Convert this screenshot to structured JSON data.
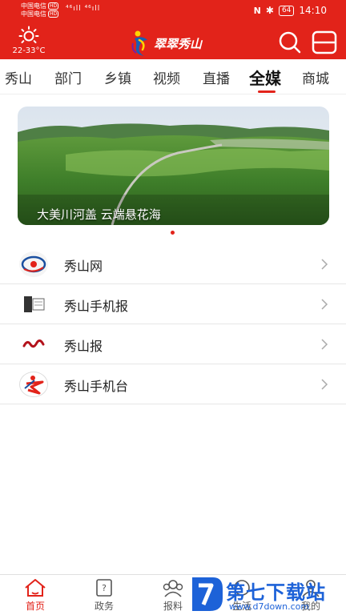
{
  "status_bar": {
    "carrier_1": "中国电信",
    "carrier_2": "中国电信",
    "hd_badge": "HD",
    "signal_text": "⁴⁶ıll ⁴⁶ıll",
    "battery": "64",
    "time": "14:10"
  },
  "header": {
    "temperature": "22-33°C",
    "logo_text": "翠翠秀山",
    "accent_color": "#e2231a"
  },
  "tabs": {
    "items": [
      {
        "label": "秀山"
      },
      {
        "label": "部门"
      },
      {
        "label": "乡镇"
      },
      {
        "label": "视频"
      },
      {
        "label": "直播"
      },
      {
        "label": "全媒"
      },
      {
        "label": "商城"
      }
    ],
    "active": "全媒"
  },
  "banner": {
    "caption": "大美川河盖 云端悬花海"
  },
  "media_list": [
    {
      "label": "秀山网",
      "icon": "xiushan-net-logo"
    },
    {
      "label": "秀山手机报",
      "icon": "mobile-newspaper-logo"
    },
    {
      "label": "秀山报",
      "icon": "xiushan-newspaper-logo"
    },
    {
      "label": "秀山手机台",
      "icon": "mobile-tv-logo"
    }
  ],
  "bottom_nav": {
    "items": [
      {
        "label": "首页",
        "icon": "home-icon"
      },
      {
        "label": "政务",
        "icon": "government-icon"
      },
      {
        "label": "报料",
        "icon": "report-icon"
      },
      {
        "label": "生活",
        "icon": "life-icon"
      },
      {
        "label": "我的",
        "icon": "profile-icon"
      }
    ],
    "active": "首页"
  },
  "watermark": {
    "title": "第七下载站",
    "url": "www.d7down.com"
  }
}
